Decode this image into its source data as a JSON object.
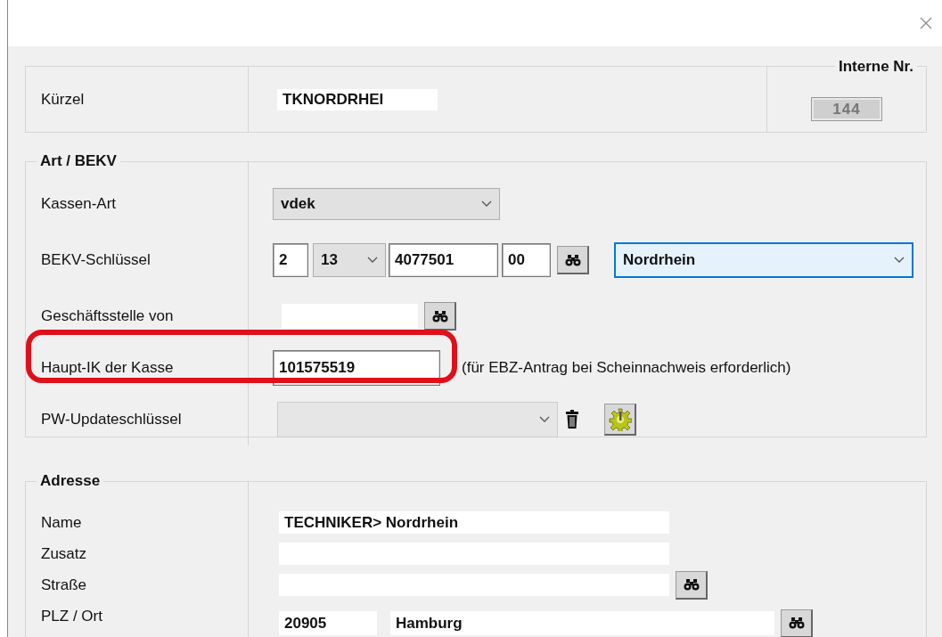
{
  "kuerzel": {
    "label": "Kürzel",
    "value": "TKNORDRHEI"
  },
  "internal_number": {
    "label": "Interne Nr.",
    "value": "144",
    "disabled": true
  },
  "art_group": {
    "title": "Art / BEKV",
    "kassen_art": {
      "label": "Kassen-Art",
      "value": "vdek"
    },
    "bekv": {
      "label": "BEKV-Schlüssel",
      "part_1": "2",
      "part_2": "13",
      "part_3": "4077501",
      "part_4": "00",
      "region": "Nordrhein",
      "region_focused": true
    },
    "geschaeftsstelle": {
      "label": "Geschäftsstelle von"
    },
    "haupt_ik": {
      "label": "Haupt-IK der Kasse",
      "value": "101575519",
      "note": "(für EBZ-Antrag bei Scheinnachweis erforderlich)",
      "highlighted": true
    },
    "pw_update": {
      "label": "PW-Updateschlüssel",
      "disabled": true
    }
  },
  "address": {
    "title": "Adresse",
    "name": {
      "label": "Name",
      "value": "TECHNIKER> Nordrhein"
    },
    "zusatz": {
      "label": "Zusatz"
    },
    "strasse": {
      "label": "Straße"
    },
    "plz_ort": {
      "label": "PLZ / Ort",
      "plz": "20905",
      "ort": "Hamburg"
    }
  }
}
